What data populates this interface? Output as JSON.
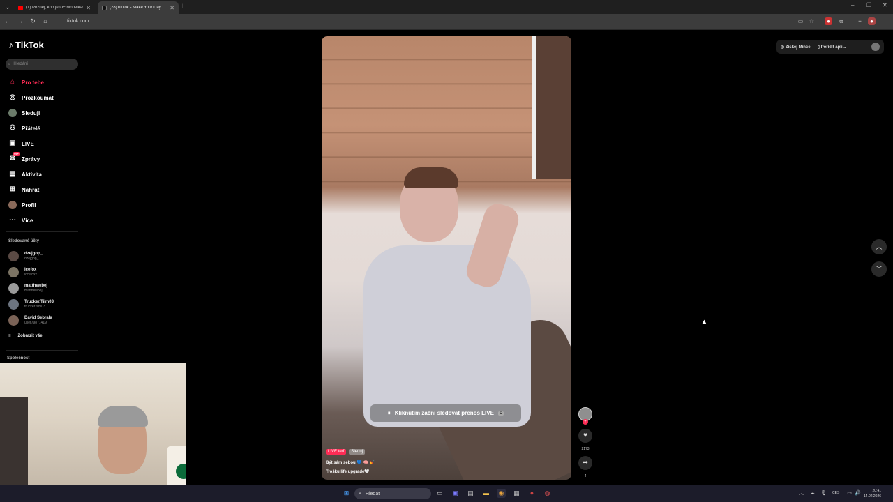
{
  "browser": {
    "tabs": [
      {
        "title": "(1) Poznej, kdo je OF Modelka!",
        "favicon_color": "#ff0000"
      },
      {
        "title": "(28)TikTok - Make Your Day",
        "favicon_color": "#111111"
      }
    ],
    "url": "tiktok.com"
  },
  "tiktok": {
    "logo_text": "TikTok",
    "search_placeholder": "Hledání",
    "nav": [
      {
        "label": "Pro tebe",
        "icon": "home-icon",
        "active": true
      },
      {
        "label": "Prozkoumat",
        "icon": "compass-icon"
      },
      {
        "label": "Sleduji",
        "icon": "following-avatar-icon"
      },
      {
        "label": "Přátelé",
        "icon": "friends-icon"
      },
      {
        "label": "LIVE",
        "icon": "live-tv-icon"
      },
      {
        "label": "Zprávy",
        "icon": "messages-icon",
        "badge": "99+"
      },
      {
        "label": "Aktivita",
        "icon": "activity-icon"
      },
      {
        "label": "Nahrát",
        "icon": "upload-icon"
      },
      {
        "label": "Profil",
        "icon": "profile-avatar-icon"
      },
      {
        "label": "Více",
        "icon": "more-icon"
      }
    ],
    "followed_title": "Sledované účty",
    "followed": [
      {
        "name": "dzejgop_",
        "handle": "dzejgop_"
      },
      {
        "name": "icefox",
        "handle": "iccefoxx"
      },
      {
        "name": "matthewbej",
        "handle": "matthewbej"
      },
      {
        "name": "Trucker.Tiim03",
        "handle": "trucker.tiim03"
      },
      {
        "name": "David Sebrala",
        "handle": "user79871419"
      }
    ],
    "show_all": "Zobrazit vše",
    "company_title": "Společnost",
    "top_actions": {
      "coins": "Získej Mince",
      "app": "Pořídit apli..."
    },
    "video": {
      "live_cta": "Kliknutím začni sledovat přenos LIVE",
      "live_cta_key": "D",
      "tag_live": "LIVE teď",
      "tag_follow": "Sleduj",
      "caption1": "Být sám sebou 💙 🧠 💅",
      "caption2": "Trošku life upgrade🤍"
    },
    "rail": {
      "like_count": "2173",
      "share_count": "4"
    }
  },
  "taskbar": {
    "search_placeholder": "Hledat",
    "lang": "CES",
    "time": "20:41",
    "date": "14.02.2026"
  }
}
